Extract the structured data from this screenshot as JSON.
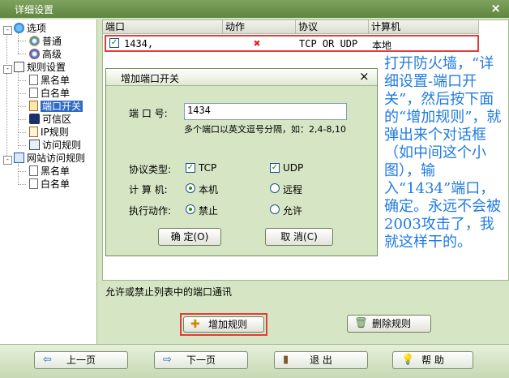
{
  "window": {
    "title": "详细设置",
    "close": "×"
  },
  "tree": {
    "options": "选项",
    "general": "普通",
    "advanced": "高级",
    "rules": "规则设置",
    "blacklist": "黑名单",
    "whitelist": "白名单",
    "port_switch": "端口开关",
    "trusted_zone": "可信区",
    "ip_rules": "IP规则",
    "access_rules": "访问规则",
    "site_access": "网站访问规则",
    "site_blacklist": "黑名单",
    "site_whitelist": "白名单",
    "plus": "+",
    "minus": "-"
  },
  "table": {
    "columns": [
      "端口",
      "动作",
      "协议",
      "计算机"
    ],
    "rows": [
      {
        "port": "1434,",
        "action_icon": "red-x-icon",
        "protocol": "TCP OR UDP",
        "computer": "本地"
      }
    ]
  },
  "annotation": "打开防火墙，“详细设置-端口开关”，然后按下面的“增加规则”，就弹出来个对话框（如中间这个小图），输入“1434”端口，确定。永远不会被2003攻击了，我就这样干的。",
  "dialog": {
    "title": "增加端口开关",
    "close": "×",
    "port_label": "端 口 号:",
    "port_value": "1434",
    "port_hint": "多个端口以英文逗号分隔，如：2,4-8,10",
    "protocol_label": "协议类型:",
    "tcp": "TCP",
    "udp": "UDP",
    "computer_label": "计 算 机:",
    "local": "本机",
    "remote": "远程",
    "action_label": "执行动作:",
    "deny": "禁止",
    "allow": "允许",
    "ok": "确 定(O)",
    "cancel": "取 消(C)"
  },
  "status": {
    "description": "允许或禁止列表中的端口通讯",
    "add_rule": "增加规则",
    "delete_rule": "删除规则"
  },
  "bottom": {
    "prev": "上一页",
    "next": "下一页",
    "exit": "退 出",
    "help": "帮 助"
  },
  "colors": {
    "accent": "#316ac5",
    "highlight_border": "#e23c3c",
    "annotation": "#1f7be0"
  }
}
